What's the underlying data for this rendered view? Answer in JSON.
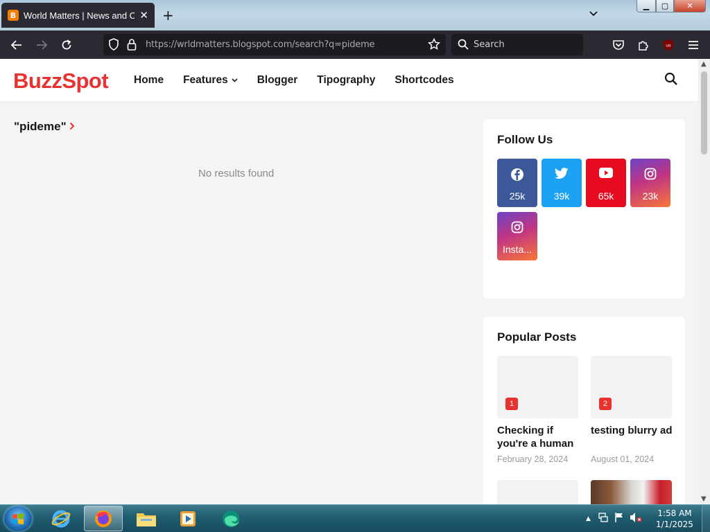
{
  "browser": {
    "tab_title": "World Matters | News and Opinions",
    "favicon_letter": "B",
    "url_host": "https://wrldmatters.blogspot.com",
    "url_path": "/search?q=pideme",
    "search_placeholder": "Search",
    "extension_badge": "uo"
  },
  "site": {
    "logo": "BuzzSpot",
    "nav": [
      "Home",
      "Features",
      "Blogger",
      "Tipography",
      "Shortcodes"
    ],
    "accent": "#e8322f"
  },
  "search": {
    "query_title": "\"pideme\"",
    "no_results": "No results found"
  },
  "follow": {
    "title": "Follow Us",
    "items": [
      {
        "network": "facebook",
        "icon": "facebook-icon",
        "count": "25k",
        "color": "#3b5998"
      },
      {
        "network": "twitter",
        "icon": "twitter-icon",
        "count": "39k",
        "color": "#1da1f2"
      },
      {
        "network": "youtube",
        "icon": "youtube-icon",
        "count": "65k",
        "color": "#e60b1e"
      },
      {
        "network": "instagram",
        "icon": "instagram-icon",
        "count": "23k",
        "color": "#c13584"
      },
      {
        "network": "instagram",
        "icon": "instagram-icon",
        "count": "Insta...",
        "color": "#c13584"
      }
    ]
  },
  "popular": {
    "title": "Popular Posts",
    "posts": [
      {
        "rank": "1",
        "title": "Checking if you're a human",
        "date": "February 28, 2024"
      },
      {
        "rank": "2",
        "title": "testing blurry ad",
        "date": "August 01, 2024"
      }
    ]
  },
  "taskbar": {
    "time": "1:58 AM",
    "date": "1/1/2025"
  }
}
